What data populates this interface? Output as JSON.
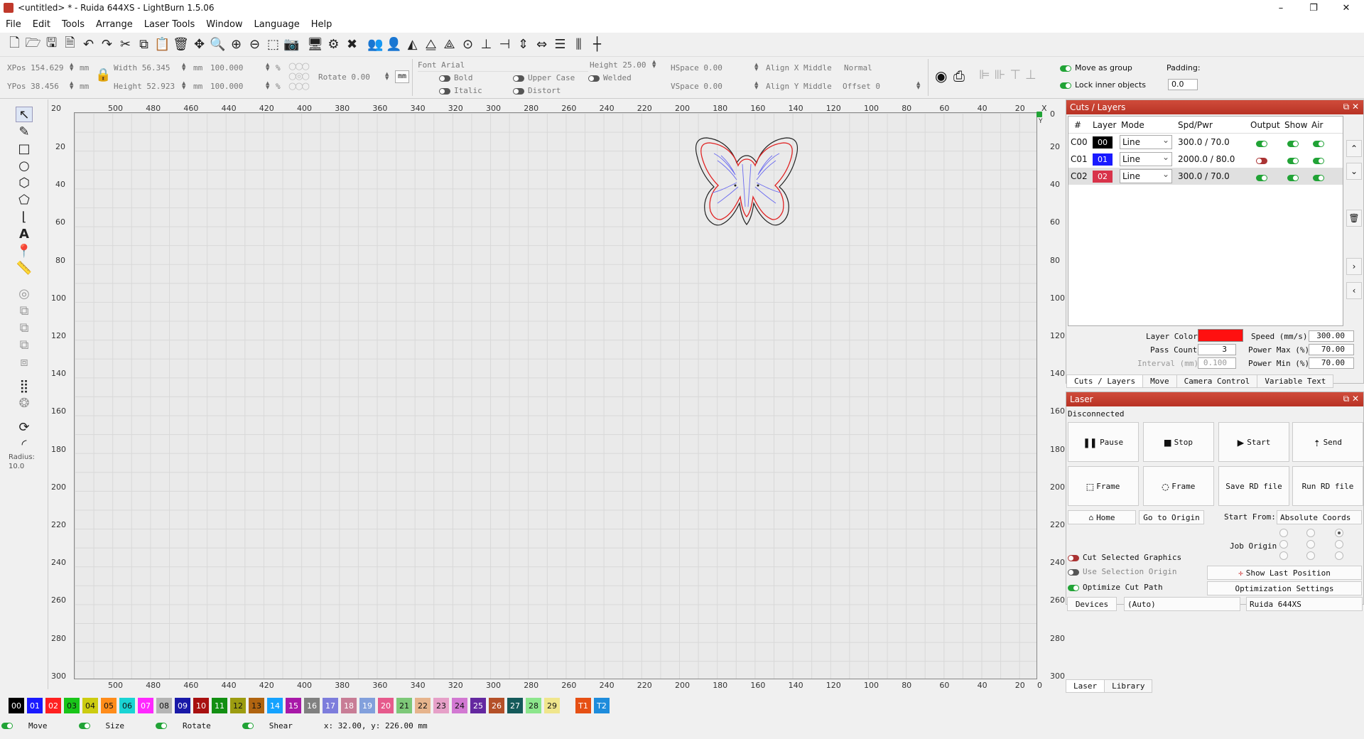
{
  "window": {
    "title": "<untitled> * - Ruida 644XS - LightBurn 1.5.06",
    "controls": [
      "–",
      "❐",
      "✕"
    ]
  },
  "menu": [
    "File",
    "Edit",
    "Tools",
    "Arrange",
    "Laser Tools",
    "Window",
    "Language",
    "Help"
  ],
  "props": {
    "xpos_label": "XPos",
    "xpos": "154.629",
    "ypos_label": "YPos",
    "ypos": "38.456",
    "width_label": "Width",
    "width": "56.345",
    "height_label": "Height",
    "height": "52.923",
    "unit": "mm",
    "scale_w": "100.000",
    "scale_h": "100.000",
    "pct": "%",
    "rotate_label": "Rotate",
    "rotate": "0.00",
    "mm_btn": "mm",
    "font": "Font Arial",
    "font_height_label": "Height",
    "font_height": "25.00",
    "bold": "Bold",
    "italic": "Italic",
    "upper": "Upper Case",
    "distort": "Distort",
    "welded": "Welded",
    "hspace": "HSpace 0.00",
    "vspace": "VSpace 0.00",
    "alignx": "Align X Middle",
    "aligny": "Align Y Middle",
    "normal": "Normal",
    "offset": "Offset 0",
    "move_group": "Move as group",
    "lock_inner": "Lock inner objects",
    "padding_label": "Padding:",
    "padding": "0.0"
  },
  "ruler": {
    "x_labels": [
      "500",
      "480",
      "460",
      "440",
      "420",
      "400",
      "380",
      "360",
      "340",
      "320",
      "300",
      "280",
      "260",
      "240",
      "220",
      "200",
      "180",
      "160",
      "140",
      "120",
      "100",
      "80",
      "60",
      "40",
      "20",
      "X"
    ],
    "y_labels": [
      "20",
      "40",
      "60",
      "80",
      "100",
      "120",
      "140",
      "160",
      "180",
      "200",
      "220",
      "240",
      "260",
      "280",
      "300"
    ],
    "top_left": "20",
    "right_top": "0",
    "y_axis": "Y",
    "bottom_end": "0"
  },
  "left": {
    "radius_label": "Radius:",
    "radius": "10.0"
  },
  "palette": [
    {
      "label": "00",
      "color": "#000000",
      "fg": "#fff"
    },
    {
      "label": "01",
      "color": "#1a1aff",
      "fg": "#fff"
    },
    {
      "label": "02",
      "color": "#ff2020",
      "fg": "#fff"
    },
    {
      "label": "03",
      "color": "#19c519",
      "fg": "#111"
    },
    {
      "label": "04",
      "color": "#cccc10",
      "fg": "#111"
    },
    {
      "label": "05",
      "color": "#ff8c1a",
      "fg": "#111"
    },
    {
      "label": "06",
      "color": "#19d4d4",
      "fg": "#111"
    },
    {
      "label": "07",
      "color": "#ff28ff",
      "fg": "#fff"
    },
    {
      "label": "08",
      "color": "#b4b4b4",
      "fg": "#111"
    },
    {
      "label": "09",
      "color": "#1919a8",
      "fg": "#fff"
    },
    {
      "label": "10",
      "color": "#a81010",
      "fg": "#fff"
    },
    {
      "label": "11",
      "color": "#128f12",
      "fg": "#fff"
    },
    {
      "label": "12",
      "color": "#9c9c10",
      "fg": "#111"
    },
    {
      "label": "13",
      "color": "#b06410",
      "fg": "#111"
    },
    {
      "label": "14",
      "color": "#14a2ff",
      "fg": "#fff"
    },
    {
      "label": "15",
      "color": "#a818a8",
      "fg": "#fff"
    },
    {
      "label": "16",
      "color": "#808080",
      "fg": "#fff"
    },
    {
      "label": "17",
      "color": "#7d7ddc",
      "fg": "#fff"
    },
    {
      "label": "18",
      "color": "#c87d96",
      "fg": "#fff"
    },
    {
      "label": "19",
      "color": "#82a0dc",
      "fg": "#fff"
    },
    {
      "label": "20",
      "color": "#e65a8c",
      "fg": "#fff"
    },
    {
      "label": "21",
      "color": "#7dc878",
      "fg": "#111"
    },
    {
      "label": "22",
      "color": "#e6b48c",
      "fg": "#111"
    },
    {
      "label": "23",
      "color": "#e6a0c8",
      "fg": "#111"
    },
    {
      "label": "24",
      "color": "#d278d2",
      "fg": "#111"
    },
    {
      "label": "25",
      "color": "#6428a0",
      "fg": "#fff"
    },
    {
      "label": "26",
      "color": "#b45028",
      "fg": "#fff"
    },
    {
      "label": "27",
      "color": "#145a5a",
      "fg": "#fff"
    },
    {
      "label": "28",
      "color": "#8ce68c",
      "fg": "#111"
    },
    {
      "label": "29",
      "color": "#f0e68c",
      "fg": "#111"
    },
    {
      "label": "T1",
      "color": "#e65014",
      "fg": "#fff"
    },
    {
      "label": "T2",
      "color": "#1e8cdc",
      "fg": "#fff"
    }
  ],
  "status": {
    "move": "Move",
    "size": "Size",
    "rotate": "Rotate",
    "shear": "Shear",
    "coords": "x: 32.00, y: 226.00 mm"
  },
  "cuts": {
    "title": "Cuts / Layers",
    "headers": [
      "#",
      "Layer",
      "Mode",
      "Spd/Pwr",
      "Output",
      "Show",
      "Air"
    ],
    "rows": [
      {
        "id": "C00",
        "layer": "00",
        "color": "#000000",
        "mode": "Line",
        "spdpwr": "300.0 / 70.0",
        "output": true
      },
      {
        "id": "C01",
        "layer": "01",
        "color": "#1a1aff",
        "mode": "Line",
        "spdpwr": "2000.0 / 80.0",
        "output": false
      },
      {
        "id": "C02",
        "layer": "02",
        "color": "#d8334a",
        "mode": "Line",
        "spdpwr": "300.0 / 70.0",
        "output": true
      }
    ],
    "layer_color_label": "Layer Color",
    "layer_color": "#ff1010",
    "pass_label": "Pass Count",
    "pass": "3",
    "interval_label": "Interval (mm)",
    "interval": "0.100",
    "speed_label": "Speed (mm/s)",
    "speed": "300.00",
    "pmax_label": "Power Max (%)",
    "pmax": "70.00",
    "pmin_label": "Power Min (%)",
    "pmin": "70.00",
    "tabs": [
      "Cuts / Layers",
      "Move",
      "Camera Control",
      "Variable Text"
    ]
  },
  "laser": {
    "title": "Laser",
    "state": "Disconnected",
    "pause": "Pause",
    "stop": "Stop",
    "start": "Start",
    "send": "Send",
    "frame1": "Frame",
    "frame2": "Frame",
    "save_rd": "Save RD file",
    "run_rd": "Run RD file",
    "home": "Home",
    "goto": "Go to Origin",
    "start_from_label": "Start From:",
    "start_from": "Absolute Coords",
    "job_origin": "Job Origin",
    "cut_selected": "Cut Selected Graphics",
    "use_sel_origin": "Use Selection Origin",
    "show_last": "Show Last Position",
    "optimize": "Optimize Cut Path",
    "opt_settings": "Optimization Settings",
    "devices": "Devices",
    "auto": "(Auto)",
    "device": "Ruida 644XS",
    "tabs": [
      "Laser",
      "Library"
    ]
  }
}
